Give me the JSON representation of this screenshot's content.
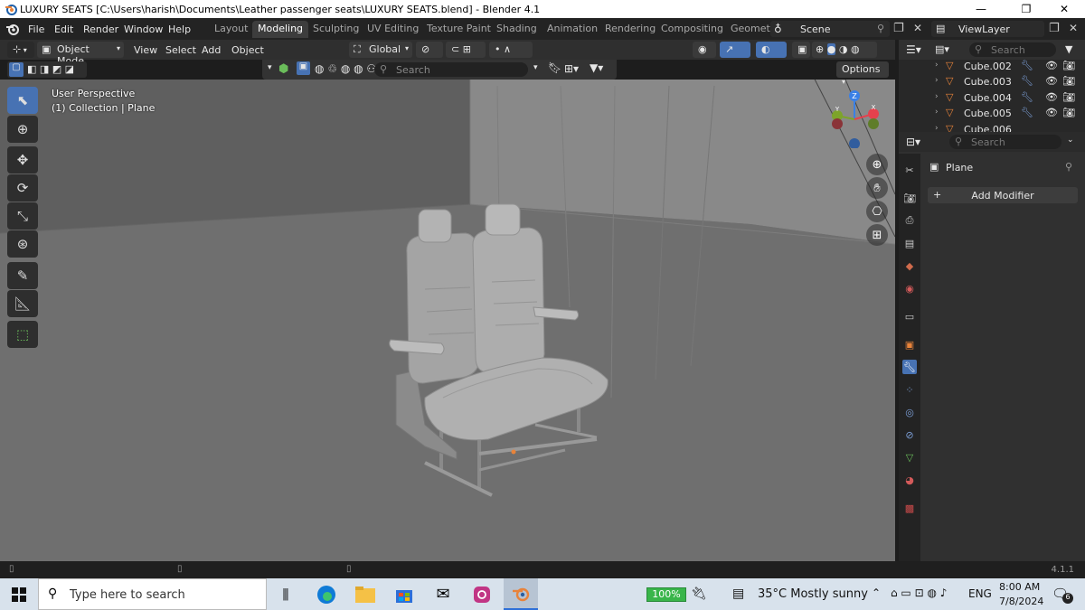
{
  "window": {
    "title": "LUXURY SEATS [C:\\Users\\harish\\Documents\\Leather passenger seats\\LUXURY SEATS.blend] - Blender 4.1",
    "minimize": "—",
    "maximize": "❐",
    "close": "✕"
  },
  "menubar": {
    "items": [
      "File",
      "Edit",
      "Render",
      "Window",
      "Help"
    ]
  },
  "workspaces": {
    "tabs": [
      "Layout",
      "Modeling",
      "Sculpting",
      "UV Editing",
      "Texture Paint",
      "Shading",
      "Animation",
      "Rendering",
      "Compositing",
      "Geomet"
    ],
    "active": "Modeling"
  },
  "scene": {
    "name": "Scene"
  },
  "view_layer": {
    "name": "ViewLayer"
  },
  "viewport_header": {
    "mode": "Object Mode",
    "menus": [
      "View",
      "Select",
      "Add",
      "Object"
    ],
    "transform_orientation": "Global",
    "options_label": "Options",
    "search_placeholder": "Search"
  },
  "viewport": {
    "perspective_label": "User Perspective",
    "collection_label": "(1) Collection | Plane",
    "gizmo": {
      "z": "Z",
      "y": "Y",
      "x": "X"
    }
  },
  "outliner": {
    "search_placeholder": "Search",
    "items": [
      "Cube.002",
      "Cube.003",
      "Cube.004",
      "Cube.005",
      "Cube.006"
    ]
  },
  "properties": {
    "search_placeholder": "Search",
    "object_name": "Plane",
    "add_modifier_label": "Add Modifier"
  },
  "statusbar": {
    "version": "4.1.1"
  },
  "taskbar": {
    "search_placeholder": "Type here to search",
    "battery": "100%",
    "weather": "35°C  Mostly sunny",
    "language": "ENG",
    "time": "8:00 AM",
    "date": "7/8/2024",
    "notifications": "6"
  },
  "colors": {
    "accent_blue": "#4772b3",
    "active_orange": "#e8833a",
    "gizmo_x": "#e5414d",
    "gizmo_y": "#7da42a",
    "gizmo_z": "#3a80e6"
  }
}
